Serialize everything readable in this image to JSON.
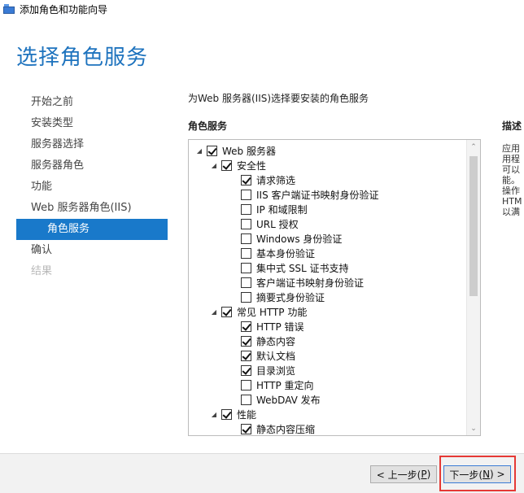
{
  "window": {
    "title": "添加角色和功能向导"
  },
  "page_title": "选择角色服务",
  "nav": [
    {
      "label": "开始之前",
      "state": "normal"
    },
    {
      "label": "安装类型",
      "state": "normal"
    },
    {
      "label": "服务器选择",
      "state": "normal"
    },
    {
      "label": "服务器角色",
      "state": "normal"
    },
    {
      "label": "功能",
      "state": "normal"
    },
    {
      "label": "Web 服务器角色(IIS)",
      "state": "normal"
    },
    {
      "label": "角色服务",
      "state": "active"
    },
    {
      "label": "确认",
      "state": "normal"
    },
    {
      "label": "结果",
      "state": "disabled"
    }
  ],
  "intro": "为Web 服务器(IIS)选择要安装的角色服务",
  "section_label": "角色服务",
  "description": {
    "label": "描述",
    "lines": [
      "应用",
      "用程",
      "可以",
      "能。",
      "操作",
      "HTM",
      "以满"
    ]
  },
  "tree": [
    {
      "label": "Web 服务器",
      "level": 0,
      "expander": "◢",
      "checked": true
    },
    {
      "label": "安全性",
      "level": 1,
      "expander": "◢",
      "checked": true
    },
    {
      "label": "请求筛选",
      "level": 2,
      "expander": "",
      "checked": true
    },
    {
      "label": "IIS 客户端证书映射身份验证",
      "level": 2,
      "expander": "",
      "checked": false
    },
    {
      "label": "IP 和域限制",
      "level": 2,
      "expander": "",
      "checked": false
    },
    {
      "label": "URL 授权",
      "level": 2,
      "expander": "",
      "checked": false
    },
    {
      "label": "Windows 身份验证",
      "level": 2,
      "expander": "",
      "checked": false
    },
    {
      "label": "基本身份验证",
      "level": 2,
      "expander": "",
      "checked": false
    },
    {
      "label": "集中式 SSL 证书支持",
      "level": 2,
      "expander": "",
      "checked": false
    },
    {
      "label": "客户端证书映射身份验证",
      "level": 2,
      "expander": "",
      "checked": false
    },
    {
      "label": "摘要式身份验证",
      "level": 2,
      "expander": "",
      "checked": false
    },
    {
      "label": "常见 HTTP 功能",
      "level": 1,
      "expander": "◢",
      "checked": true
    },
    {
      "label": "HTTP 错误",
      "level": 2,
      "expander": "",
      "checked": true
    },
    {
      "label": "静态内容",
      "level": 2,
      "expander": "",
      "checked": true
    },
    {
      "label": "默认文档",
      "level": 2,
      "expander": "",
      "checked": true
    },
    {
      "label": "目录浏览",
      "level": 2,
      "expander": "",
      "checked": true
    },
    {
      "label": "HTTP 重定向",
      "level": 2,
      "expander": "",
      "checked": false
    },
    {
      "label": "WebDAV 发布",
      "level": 2,
      "expander": "",
      "checked": false
    },
    {
      "label": "性能",
      "level": 1,
      "expander": "◢",
      "checked": true
    },
    {
      "label": "静态内容压缩",
      "level": 2,
      "expander": "",
      "checked": true
    }
  ],
  "scroll": {
    "up_glyph": "⌃",
    "down_glyph": "⌄"
  },
  "buttons": {
    "prev": {
      "pre": "< 上一步(",
      "key": "P",
      "post": ")"
    },
    "next": {
      "pre": "下一步(",
      "key": "N",
      "post": ") >"
    }
  },
  "colors": {
    "accent": "#1979ca",
    "title": "#1e73be",
    "highlight": "#e53935"
  }
}
